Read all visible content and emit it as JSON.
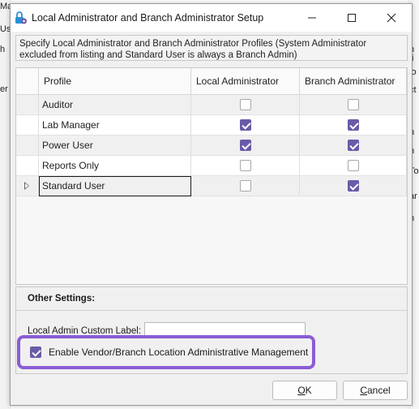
{
  "background": {
    "left_fragments": [
      "Ma",
      "Use",
      "h",
      "er"
    ],
    "right_fragments": [
      "h",
      "ti",
      "io",
      "ct",
      "n",
      "n",
      "To",
      "ar",
      "n"
    ]
  },
  "window": {
    "title": "Local Administrator and Branch Administrator Setup",
    "accent_color": "#6b5aa8",
    "highlight_color": "#8a5cd6"
  },
  "description": "Specify Local Administrator and Branch Administrator Profiles (System Administrator excluded from listing and Standard User is always a Branch Admin)",
  "grid": {
    "columns": [
      "Profile",
      "Local Administrator",
      "Branch Administrator"
    ],
    "rows": [
      {
        "profile": "Auditor",
        "local": false,
        "branch": false
      },
      {
        "profile": "Lab Manager",
        "local": true,
        "branch": true
      },
      {
        "profile": "Power User",
        "local": true,
        "branch": true
      },
      {
        "profile": "Reports Only",
        "local": false,
        "branch": false
      },
      {
        "profile": "Standard User",
        "local": false,
        "branch": true
      }
    ]
  },
  "settings": {
    "title": "Other Settings:",
    "custom_label": "Local Admin Custom Label:",
    "custom_value": "",
    "vendor_label": "Enable Vendor/Branch Location Administrative Management",
    "vendor_checked": true
  },
  "buttons": {
    "ok_mnemonic": "O",
    "ok_rest": "K",
    "cancel_mnemonic": "C",
    "cancel_rest": "ancel"
  }
}
